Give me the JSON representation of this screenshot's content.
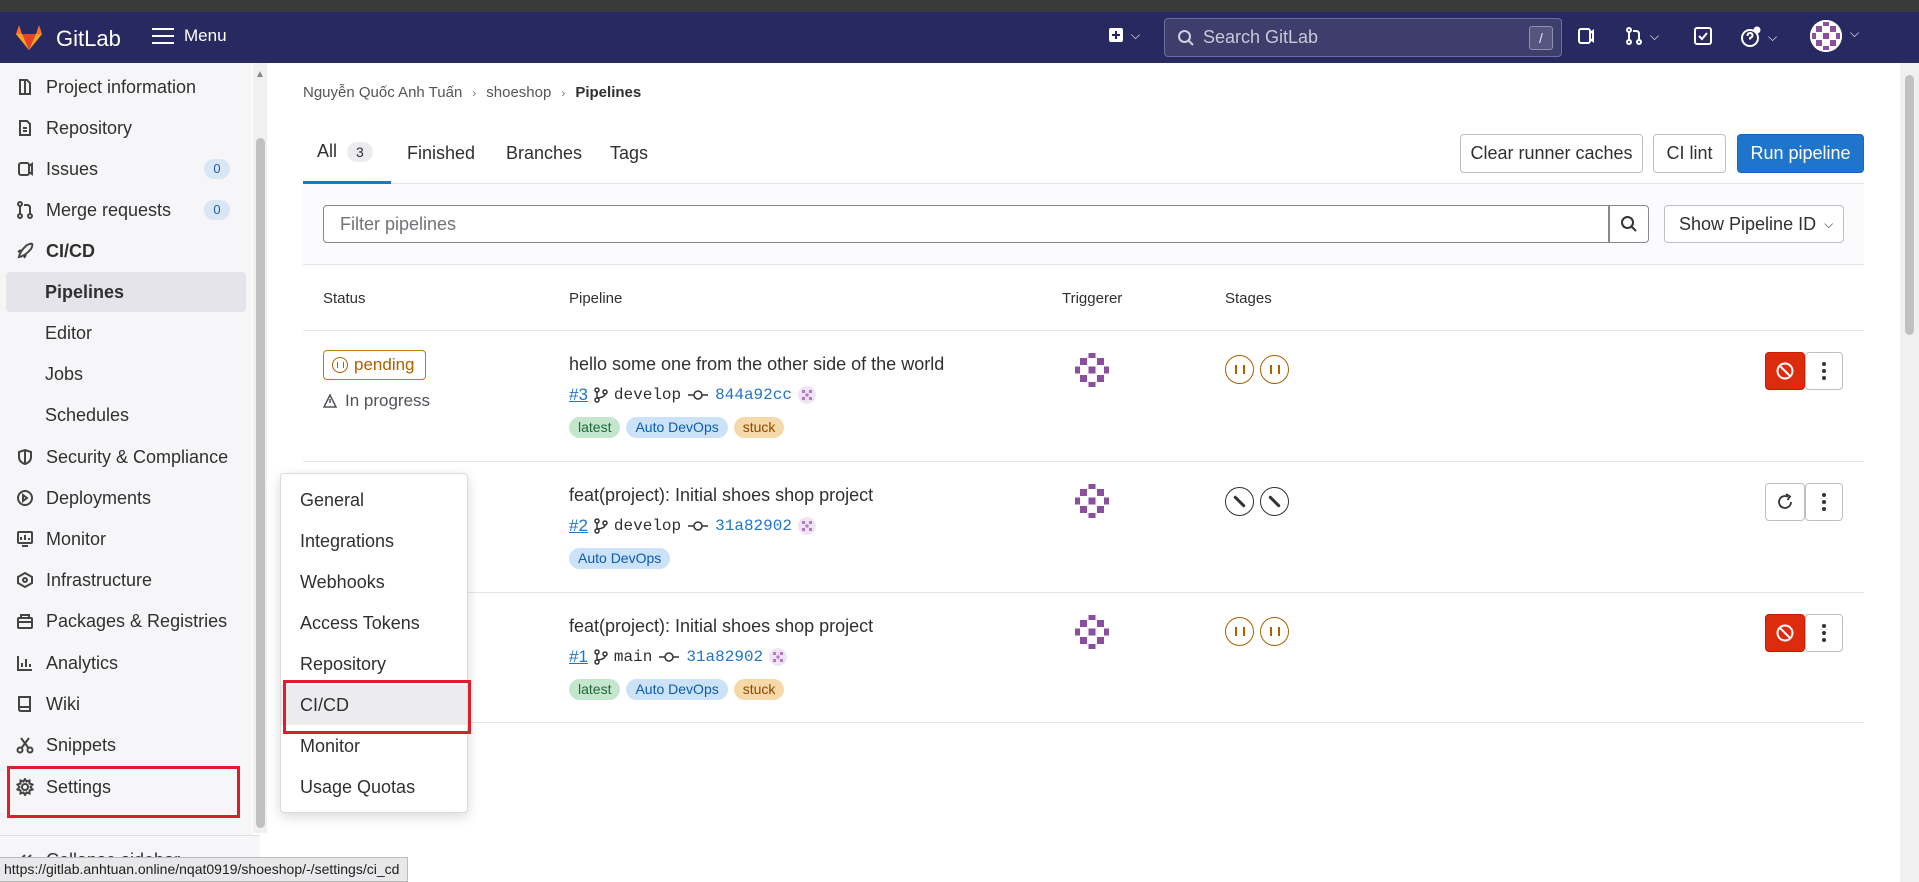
{
  "header": {
    "brand": "GitLab",
    "menu_label": "Menu",
    "search_placeholder": "Search GitLab",
    "search_shortcut": "/"
  },
  "sidebar": {
    "items": [
      {
        "label": "Project information",
        "icon": "info-icon"
      },
      {
        "label": "Repository",
        "icon": "document-icon"
      },
      {
        "label": "Issues",
        "icon": "issues-icon",
        "count": "0"
      },
      {
        "label": "Merge requests",
        "icon": "merge-request-icon",
        "count": "0"
      },
      {
        "label": "CI/CD",
        "icon": "rocket-icon"
      },
      {
        "label": "Pipelines"
      },
      {
        "label": "Editor"
      },
      {
        "label": "Jobs"
      },
      {
        "label": "Schedules"
      },
      {
        "label": "Security & Compliance",
        "icon": "shield-icon"
      },
      {
        "label": "Deployments",
        "icon": "deployments-icon"
      },
      {
        "label": "Monitor",
        "icon": "monitor-icon"
      },
      {
        "label": "Infrastructure",
        "icon": "infrastructure-icon"
      },
      {
        "label": "Packages & Registries",
        "icon": "package-icon"
      },
      {
        "label": "Analytics",
        "icon": "analytics-icon"
      },
      {
        "label": "Wiki",
        "icon": "book-icon"
      },
      {
        "label": "Snippets",
        "icon": "scissors-icon"
      },
      {
        "label": "Settings",
        "icon": "gear-icon"
      }
    ],
    "collapse_label": "Collapse sidebar"
  },
  "status_url": "https://gitlab.anhtuan.online/nqat0919/shoeshop/-/settings/ci_cd",
  "breadcrumb": [
    "Nguyễn Quốc Anh Tuấn",
    "shoeshop",
    "Pipelines"
  ],
  "tabs": [
    {
      "label": "All",
      "count": "3"
    },
    {
      "label": "Finished"
    },
    {
      "label": "Branches"
    },
    {
      "label": "Tags"
    }
  ],
  "actions": {
    "clear_caches": "Clear runner caches",
    "ci_lint": "CI lint",
    "run_pipeline": "Run pipeline"
  },
  "filter": {
    "placeholder": "Filter pipelines",
    "show_id": "Show Pipeline ID"
  },
  "table": {
    "headers": [
      "Status",
      "Pipeline",
      "Triggerer",
      "Stages"
    ],
    "rows": [
      {
        "status": "pending",
        "substatus": "In progress",
        "title": "hello some one from the other side of the world",
        "id": "#3",
        "ref": "develop",
        "sha": "844a92cc",
        "tags": [
          "latest",
          "Auto DevOps",
          "stuck"
        ]
      },
      {
        "title": "feat(project): Initial shoes shop project",
        "id": "#2",
        "ref": "develop",
        "sha": "31a82902",
        "tags": [
          "Auto DevOps"
        ]
      },
      {
        "title": "feat(project): Initial shoes shop project",
        "id": "#1",
        "ref": "main",
        "sha": "31a82902",
        "tags": [
          "latest",
          "Auto DevOps",
          "stuck"
        ]
      }
    ]
  },
  "settings_menu": [
    "General",
    "Integrations",
    "Webhooks",
    "Access Tokens",
    "Repository",
    "CI/CD",
    "Monitor",
    "Usage Quotas"
  ],
  "colors": {
    "header_bg": "#292961",
    "primary": "#1f75cb",
    "danger": "#dd2b0e",
    "pending": "#ab6100",
    "highlight": "#dd1e2f"
  }
}
